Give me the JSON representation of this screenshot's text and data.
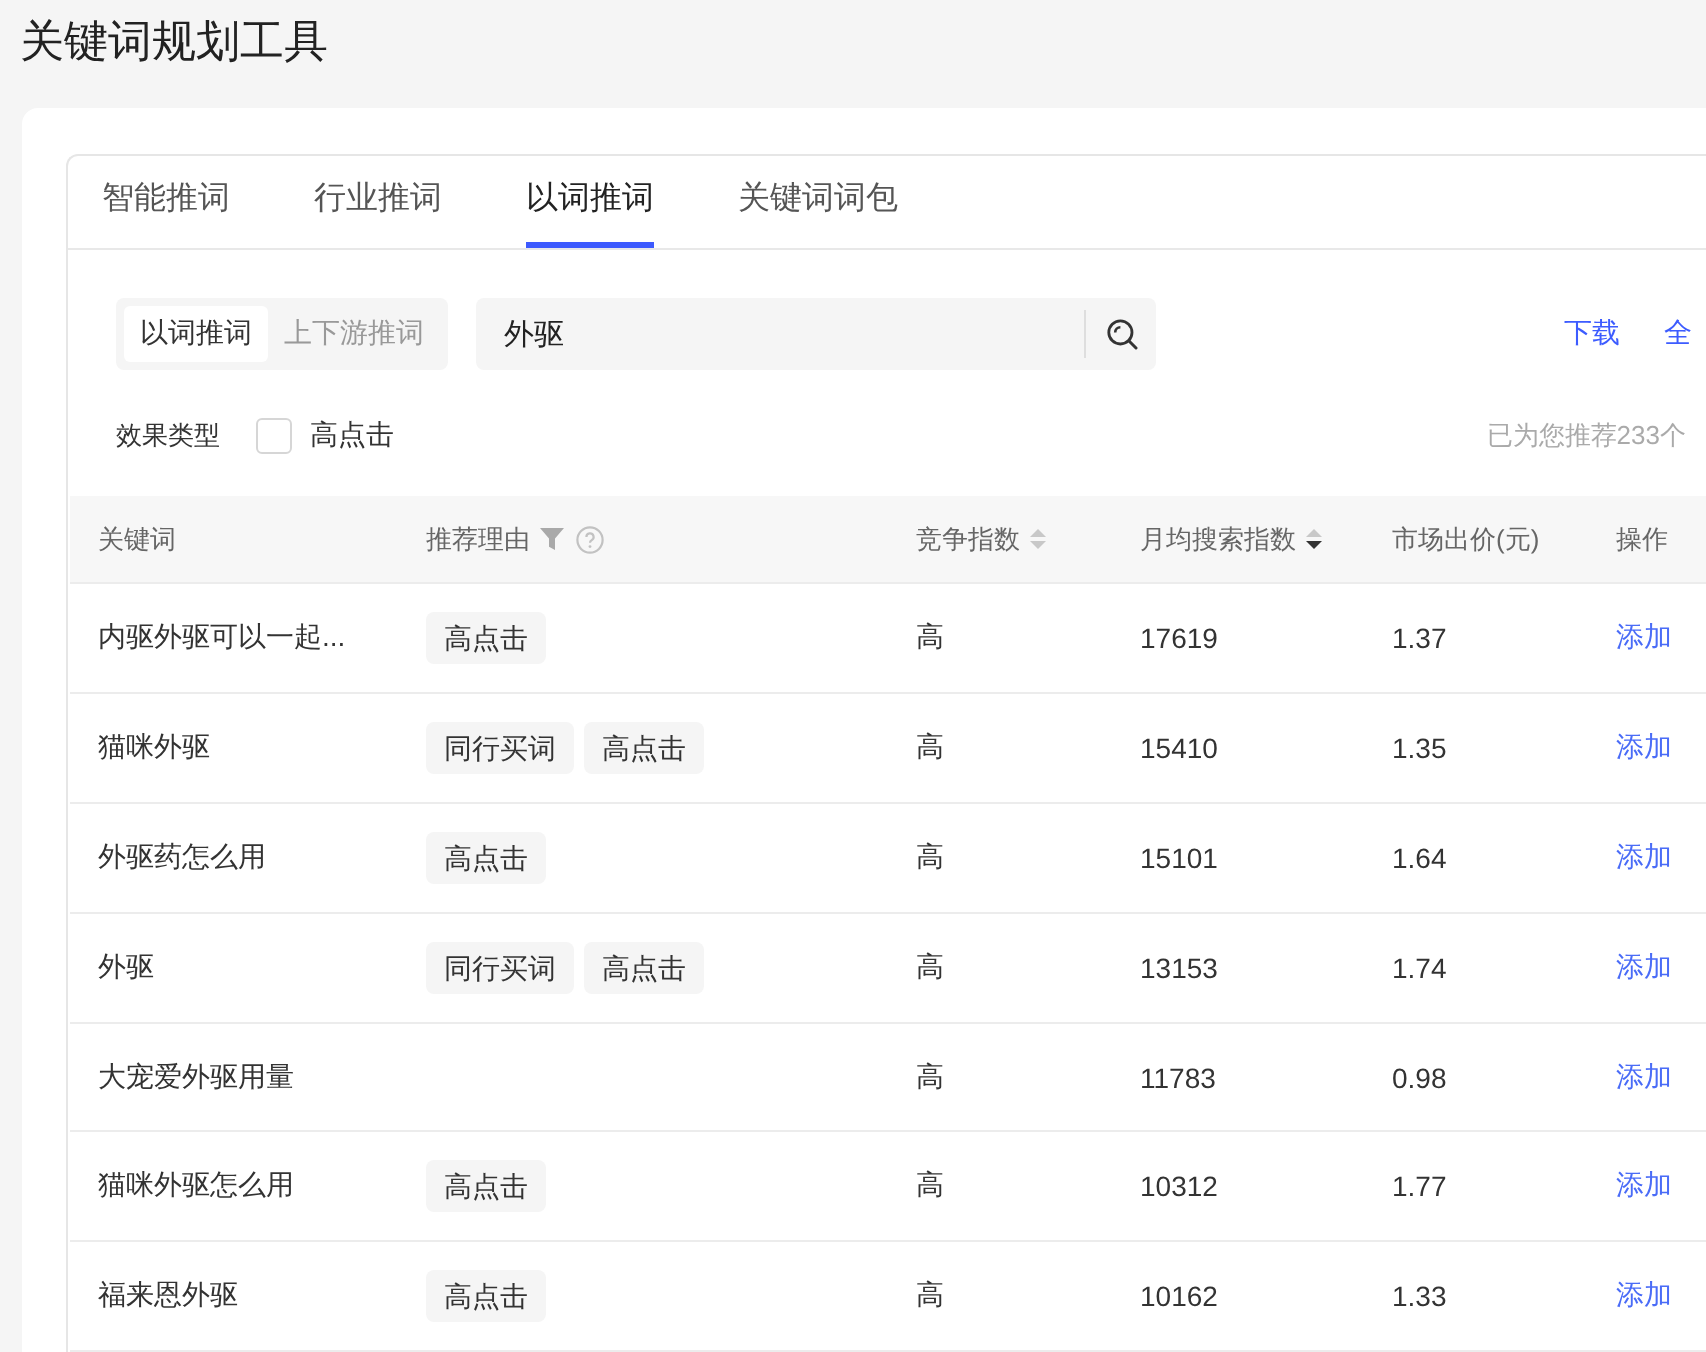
{
  "page": {
    "title": "关键词规划工具"
  },
  "tabs": [
    {
      "label": "智能推词",
      "selected": false
    },
    {
      "label": "行业推词",
      "selected": false
    },
    {
      "label": "以词推词",
      "selected": true
    },
    {
      "label": "关键词词包",
      "selected": false
    }
  ],
  "toolbar": {
    "modes": [
      {
        "label": "以词推词",
        "selected": true
      },
      {
        "label": "上下游推词",
        "selected": false
      }
    ],
    "search": {
      "value": "外驱"
    },
    "links": [
      "下载",
      "全"
    ]
  },
  "filter": {
    "label": "效果类型",
    "options": [
      {
        "label": "高点击",
        "checked": false
      }
    ],
    "summary": "已为您推荐233个"
  },
  "table": {
    "columns": [
      {
        "label": "关键词"
      },
      {
        "label": "推荐理由",
        "filter": true,
        "help": true
      },
      {
        "label": "竞争指数",
        "sortable": true,
        "sorted_desc": false
      },
      {
        "label": "月均搜索指数",
        "sortable": true,
        "sorted_desc": true
      },
      {
        "label": "市场出价(元)"
      },
      {
        "label": "操作"
      }
    ],
    "rows": [
      {
        "keyword": "内驱外驱可以一起...",
        "reasons": [
          "高点击"
        ],
        "competition": "高",
        "monthly_search": "17619",
        "bid": "1.37",
        "action": "添加"
      },
      {
        "keyword": "猫咪外驱",
        "reasons": [
          "同行买词",
          "高点击"
        ],
        "competition": "高",
        "monthly_search": "15410",
        "bid": "1.35",
        "action": "添加"
      },
      {
        "keyword": "外驱药怎么用",
        "reasons": [
          "高点击"
        ],
        "competition": "高",
        "monthly_search": "15101",
        "bid": "1.64",
        "action": "添加"
      },
      {
        "keyword": "外驱",
        "reasons": [
          "同行买词",
          "高点击"
        ],
        "competition": "高",
        "monthly_search": "13153",
        "bid": "1.74",
        "action": "添加"
      },
      {
        "keyword": "大宠爱外驱用量",
        "reasons": [],
        "competition": "高",
        "monthly_search": "11783",
        "bid": "0.98",
        "action": "添加"
      },
      {
        "keyword": "猫咪外驱怎么用",
        "reasons": [
          "高点击"
        ],
        "competition": "高",
        "monthly_search": "10312",
        "bid": "1.77",
        "action": "添加"
      },
      {
        "keyword": "福来恩外驱",
        "reasons": [
          "高点击"
        ],
        "competition": "高",
        "monthly_search": "10162",
        "bid": "1.33",
        "action": "添加"
      }
    ]
  }
}
